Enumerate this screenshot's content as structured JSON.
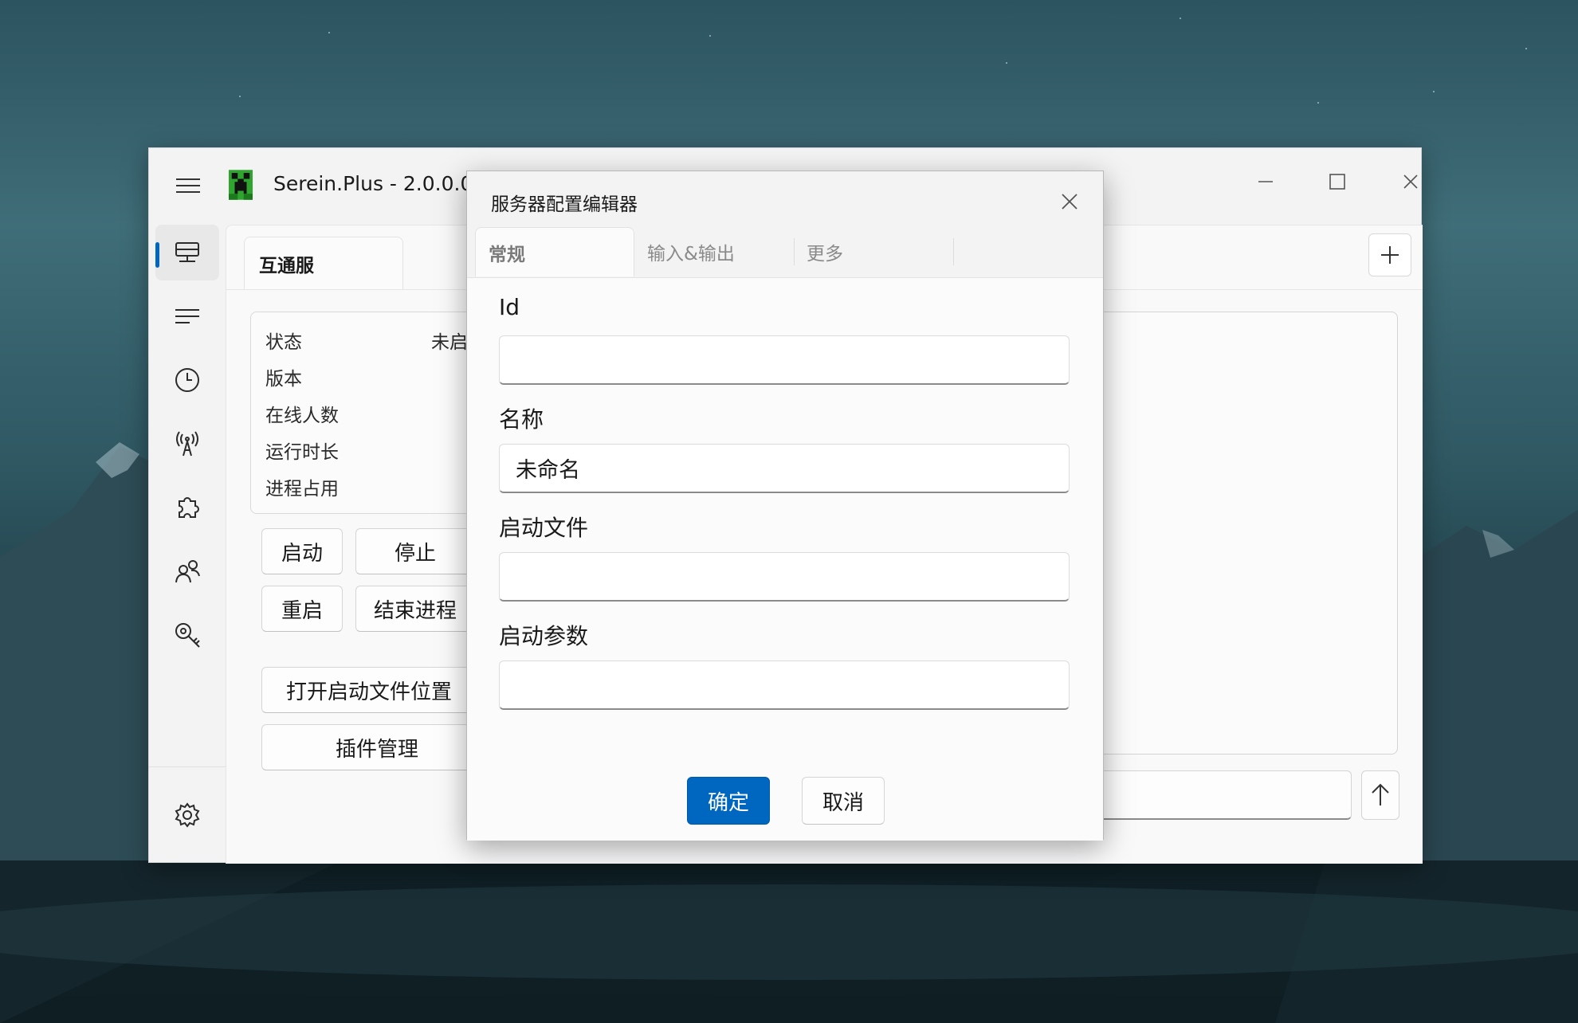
{
  "window": {
    "title": "Serein.Plus - 2.0.0.0"
  },
  "sidebar": {
    "items": [
      {
        "icon": "server-icon",
        "active": true
      },
      {
        "icon": "console-list-icon"
      },
      {
        "icon": "clock-icon"
      },
      {
        "icon": "broadcast-icon"
      },
      {
        "icon": "puzzle-icon"
      },
      {
        "icon": "players-icon"
      },
      {
        "icon": "key-search-icon"
      }
    ],
    "settings_icon": "gear-icon"
  },
  "server_tab": {
    "label": "互通服"
  },
  "info": {
    "rows": [
      {
        "label": "状态",
        "value": "未启"
      },
      {
        "label": "版本",
        "value": ""
      },
      {
        "label": "在线人数",
        "value": ""
      },
      {
        "label": "运行时长",
        "value": ""
      },
      {
        "label": "进程占用",
        "value": ""
      }
    ]
  },
  "controls": {
    "start": "启动",
    "stop": "停止",
    "restart": "重启",
    "kill": "结束进程",
    "open_location": "打开启动文件位置",
    "plugins": "插件管理"
  },
  "dialog": {
    "title": "服务器配置编辑器",
    "tabs": [
      "常规",
      "输入&输出",
      "更多"
    ],
    "active_tab": "常规",
    "fields": [
      {
        "label": "Id",
        "value": ""
      },
      {
        "label": "名称",
        "value": "未命名"
      },
      {
        "label": "启动文件",
        "value": ""
      },
      {
        "label": "启动参数",
        "value": ""
      }
    ],
    "ok": "确定",
    "cancel": "取消"
  },
  "colors": {
    "accent": "#0067c0"
  }
}
